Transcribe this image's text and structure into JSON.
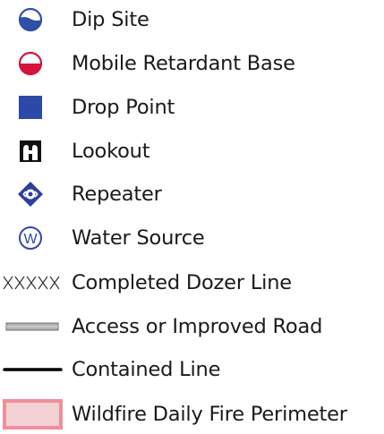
{
  "legend": {
    "items": [
      {
        "label": "Dip Site",
        "icon": "dip-site-icon"
      },
      {
        "label": "Mobile Retardant Base",
        "icon": "mobile-retardant-base-icon"
      },
      {
        "label": "Drop Point",
        "icon": "drop-point-icon"
      },
      {
        "label": "Lookout",
        "icon": "lookout-icon"
      },
      {
        "label": "Repeater",
        "icon": "repeater-icon"
      },
      {
        "label": "Water Source",
        "icon": "water-source-icon"
      },
      {
        "label": "Completed Dozer Line",
        "icon": "completed-dozer-line-icon"
      },
      {
        "label": "Access or Improved Road",
        "icon": "access-road-line-icon"
      },
      {
        "label": "Contained Line",
        "icon": "contained-line-icon"
      },
      {
        "label": "Wildfire Daily Fire Perimeter",
        "icon": "fire-perimeter-icon"
      }
    ],
    "water_source_glyph": "W",
    "colors": {
      "dip_site_blue": "#2f4fa8",
      "retardant_red": "#d4143c",
      "drop_point_blue": "#2c49a8",
      "repeater_blue": "#2f3f9c",
      "water_source_blue": "#3545b0",
      "road_gray": "#b3b3b3",
      "perimeter_fill": "#f3d1d5",
      "perimeter_edge": "#ef8f9a"
    }
  }
}
